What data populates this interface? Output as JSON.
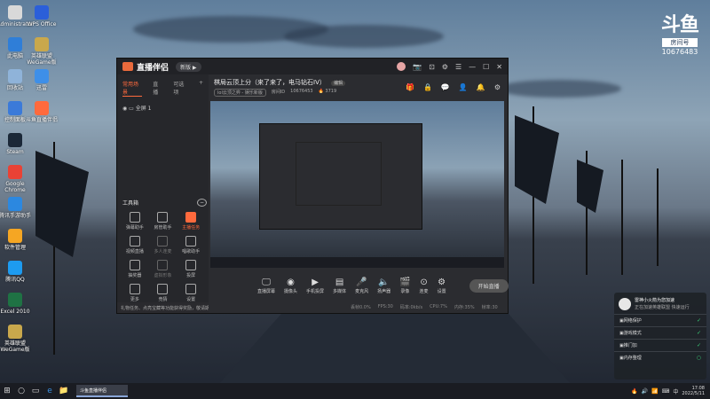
{
  "desktop": {
    "icons": [
      {
        "label": "Administrator",
        "color": "#d9d9d9"
      },
      {
        "label": "此电脑",
        "color": "#2f7ed8"
      },
      {
        "label": "回收站",
        "color": "#8fb3d9"
      },
      {
        "label": "控制面板",
        "color": "#3b7ad9"
      },
      {
        "label": "Steam",
        "color": "#1b2838"
      },
      {
        "label": "Google Chrome",
        "color": "#e94235"
      },
      {
        "label": "腾讯手游助手",
        "color": "#2c88e0"
      },
      {
        "label": "软件管理",
        "color": "#f5a623"
      },
      {
        "label": "腾讯QQ",
        "color": "#1d9bf0"
      },
      {
        "label": "Excel 2010",
        "color": "#1f7244"
      },
      {
        "label": "英雄联盟 WeGame版",
        "color": "#c9a84c"
      }
    ],
    "icons_col2": [
      {
        "label": "WPS Office",
        "color": "#2b5fd9"
      },
      {
        "label": "英雄联盟 WeGame版",
        "color": "#c9a84c"
      },
      {
        "label": "迅雷",
        "color": "#3e8fe8"
      },
      {
        "label": "斗鱼直播伴侣",
        "color": "#ff6a3d"
      }
    ],
    "douyu_logo": {
      "title": "斗鱼",
      "room_label": "房间号",
      "room_number": "10676483"
    }
  },
  "app": {
    "brand": "直播伴侣",
    "version_chip": "新版 ▶",
    "window_controls": [
      "📷",
      "⊡",
      "⚙",
      "☰",
      "—",
      "☐",
      "✕"
    ],
    "left_tabs": [
      "常用场景",
      "直播",
      "可选项"
    ],
    "add_tab": "+",
    "scene_name": "全屏 1",
    "tools_header": "工具箱",
    "tools_toggle": "−",
    "tools": [
      {
        "label": "弹幕助手",
        "state": "normal"
      },
      {
        "label": "房管助手",
        "state": "normal"
      },
      {
        "label": "主播任务",
        "state": "hot"
      },
      {
        "label": "视频直播",
        "state": "normal"
      },
      {
        "label": "多人连麦",
        "state": "dim"
      },
      {
        "label": "唱歌助手",
        "state": "normal"
      },
      {
        "label": "抽奖器",
        "state": "normal"
      },
      {
        "label": "虚拟形象",
        "state": "dim"
      },
      {
        "label": "投屏",
        "state": "normal"
      },
      {
        "label": "更多",
        "state": "normal"
      },
      {
        "label": "竞猜",
        "state": "normal"
      },
      {
        "label": "设置",
        "state": "normal"
      }
    ],
    "notice": "礼物任务、点亮宝藏等功能获得奖励，敬请期待",
    "room": {
      "title": "棋局云顶上分（来了来了，电马钻石IV）",
      "edit_label": "编辑",
      "category": "lol云顶之弈 - 娱乐新版",
      "room_id_label": "房间ID",
      "room_id": "10676453",
      "heat": "🔥 3719"
    },
    "room_icons": [
      "🎁",
      "🔒",
      "💬",
      "👤",
      "🔔",
      "⚙"
    ],
    "bottom_buttons": [
      {
        "icon": "🖵",
        "label": "直播屏幕"
      },
      {
        "icon": "◉",
        "label": "摄像头"
      },
      {
        "icon": "▶",
        "label": "手机投屏"
      },
      {
        "icon": "▤",
        "label": "多媒体"
      },
      {
        "icon": "🎤",
        "label": "麦克风"
      },
      {
        "icon": "🔈",
        "label": "扬声器"
      },
      {
        "icon": "🎬",
        "label": "录像"
      },
      {
        "icon": "⊙",
        "label": "连麦"
      },
      {
        "icon": "⚙",
        "label": "设置"
      }
    ],
    "start_live": "开始直播",
    "status": [
      "丢帧0.0%",
      "FPS:30",
      "码率:0kb/s",
      "CPU:7%",
      "内存:35%",
      "帧率:30"
    ]
  },
  "notification": {
    "title": "雷神小火箭为您加速",
    "subtitle": "正在加速英雄联盟 快速运行",
    "rows": [
      {
        "label": "网络保护",
        "check": "✓"
      },
      {
        "label": "游戏模式",
        "check": "✓"
      },
      {
        "label": "推门加",
        "check": "✓"
      },
      {
        "label": "内存整理",
        "check": "○"
      }
    ]
  },
  "taskbar": {
    "start_icon": "⊞",
    "search_icon": "○",
    "taskview_icon": "▭",
    "pinned": [
      "e",
      "📁"
    ],
    "active_app": "斗鱼直播伴侣",
    "tray_icons": [
      "🔥",
      "🔊",
      "📶",
      "⌨"
    ],
    "ime": "中",
    "time": "17:08",
    "date": "2022/5/11"
  }
}
